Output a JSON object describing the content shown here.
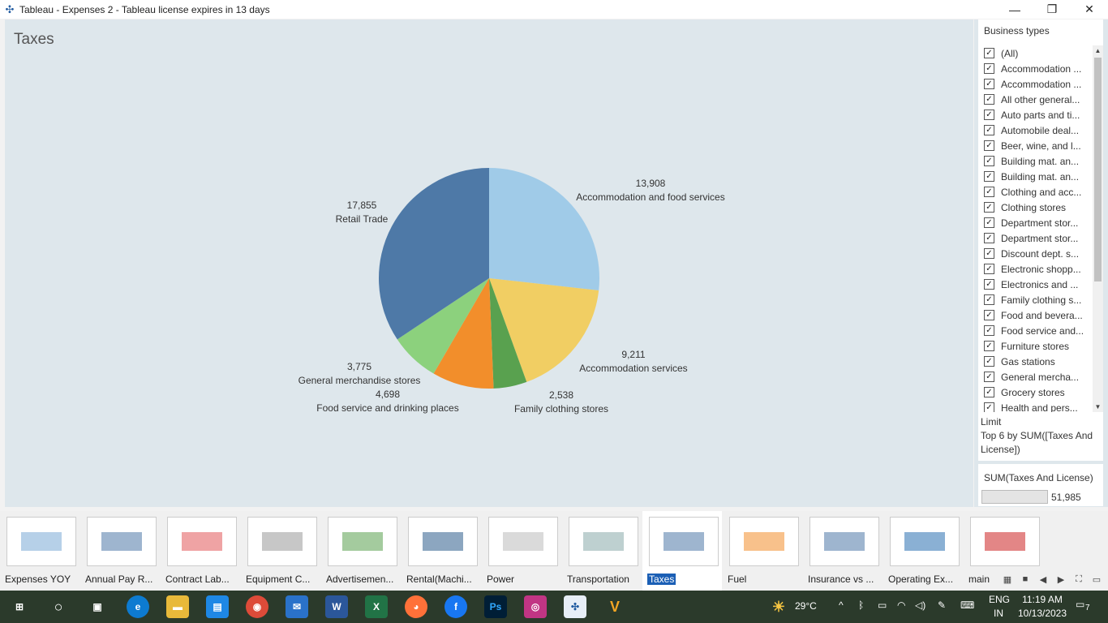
{
  "window": {
    "title": "Tableau - Expenses 2 - Tableau license expires in 13 days"
  },
  "sheet": {
    "title": "Taxes"
  },
  "chart_data": {
    "type": "pie",
    "slices": [
      {
        "label": "Accommodation and food services",
        "value": 13908,
        "display": "13,908",
        "color": "#a0cbe8"
      },
      {
        "label": "Accommodation services",
        "value": 9211,
        "display": "9,211",
        "color": "#f1ce63"
      },
      {
        "label": "Family clothing stores",
        "value": 2538,
        "display": "2,538",
        "color": "#59a14f"
      },
      {
        "label": "Food service and drinking places",
        "value": 4698,
        "display": "4,698",
        "color": "#f28e2b"
      },
      {
        "label": "General merchandise stores",
        "value": 3775,
        "display": "3,775",
        "color": "#8cd17d"
      },
      {
        "label": "Retail Trade",
        "value": 17855,
        "display": "17,855",
        "color": "#4e79a7"
      }
    ]
  },
  "filter": {
    "title": "Business types",
    "items": [
      "(All)",
      "Accommodation ...",
      "Accommodation ...",
      "All other general...",
      "Auto parts and ti...",
      "Automobile deal...",
      "Beer, wine, and l...",
      "Building mat. an...",
      "Building mat. an...",
      "Clothing and acc...",
      "Clothing stores",
      "Department stor...",
      "Department stor...",
      "Discount dept. s...",
      "Electronic shopp...",
      "Electronics and ...",
      "Family clothing s...",
      "Food and bevera...",
      "Food service and...",
      "Furniture stores",
      "Gas stations",
      "General mercha...",
      "Grocery stores",
      "Health and pers..."
    ],
    "check": "✓",
    "limit_label": "Limit",
    "limit_text": "Top 6 by SUM([Taxes And License])"
  },
  "legend": {
    "title": "SUM(Taxes And License)",
    "value": "51,985"
  },
  "tabs": [
    "Expenses YOY",
    "Annual Pay R...",
    "Contract Lab...",
    "Equipment C...",
    "Advertisemen...",
    "Rental(Machi...",
    "Power",
    "Transportation",
    "Taxes",
    "Fuel",
    "Insurance vs ...",
    "Operating Ex...",
    "main"
  ],
  "active_tab": "Taxes",
  "taskbar": {
    "temperature": "29°C",
    "lang1": "ENG",
    "lang2": "IN",
    "time": "11:19 AM",
    "date": "10/13/2023",
    "notif": "7"
  }
}
